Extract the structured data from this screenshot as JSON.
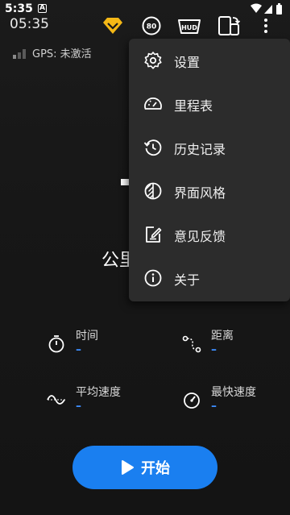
{
  "status_bar": {
    "time": "5:35",
    "notification_letter": "A"
  },
  "app_bar": {
    "clock": "05:35",
    "icons": [
      "premium-badge-icon",
      "speed-limit-icon",
      "hud-icon",
      "screen-rotate-icon",
      "more-vert-icon"
    ],
    "speed_limit_label": "80",
    "hud_label": "HUD"
  },
  "gps": {
    "status_text": "GPS: 未激活"
  },
  "speedometer": {
    "speed_value": "-",
    "unit_partial": "公里"
  },
  "stats": {
    "time": {
      "label": "时间",
      "value": "–"
    },
    "distance": {
      "label": "距离",
      "value": "–"
    },
    "avg_speed": {
      "label": "平均速度",
      "value": "–"
    },
    "max_speed": {
      "label": "最快速度",
      "value": "–"
    }
  },
  "start_button": {
    "label": "开始"
  },
  "menu": {
    "items": [
      {
        "label": "设置",
        "icon": "gear-icon"
      },
      {
        "label": "里程表",
        "icon": "odometer-icon"
      },
      {
        "label": "历史记录",
        "icon": "history-icon"
      },
      {
        "label": "界面风格",
        "icon": "theme-icon"
      },
      {
        "label": "意见反馈",
        "icon": "feedback-icon"
      },
      {
        "label": "关于",
        "icon": "info-icon"
      }
    ]
  },
  "colors": {
    "accent": "#1a7ff0",
    "value_blue": "#3d8eff",
    "badge_yellow": "#f5b816",
    "menu_bg": "#2c2c2c"
  }
}
